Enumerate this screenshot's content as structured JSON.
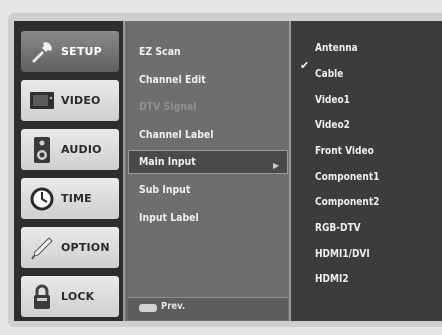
{
  "sidebar": {
    "items": [
      {
        "label": "SETUP",
        "icon": "wrench-icon"
      },
      {
        "label": "VIDEO",
        "icon": "tv-icon"
      },
      {
        "label": "AUDIO",
        "icon": "speaker-icon"
      },
      {
        "label": "TIME",
        "icon": "clock-icon"
      },
      {
        "label": "OPTION",
        "icon": "pen-icon"
      },
      {
        "label": "LOCK",
        "icon": "padlock-icon"
      }
    ]
  },
  "submenu": {
    "items": [
      {
        "label": "EZ Scan"
      },
      {
        "label": "Channel Edit"
      },
      {
        "label": "DTV Signal"
      },
      {
        "label": "Channel Label"
      },
      {
        "label": "Main Input"
      },
      {
        "label": "Sub Input"
      },
      {
        "label": "Input Label"
      }
    ],
    "selected": "Main Input",
    "prev_label": "Prev."
  },
  "options": {
    "selected": "Antenna",
    "items": [
      {
        "label": "Antenna"
      },
      {
        "label": "Cable"
      },
      {
        "label": "Video1"
      },
      {
        "label": "Video2"
      },
      {
        "label": "Front Video"
      },
      {
        "label": "Component1"
      },
      {
        "label": "Component2"
      },
      {
        "label": "RGB-DTV"
      },
      {
        "label": "HDMI1/DVI"
      },
      {
        "label": "HDMI2"
      }
    ]
  }
}
